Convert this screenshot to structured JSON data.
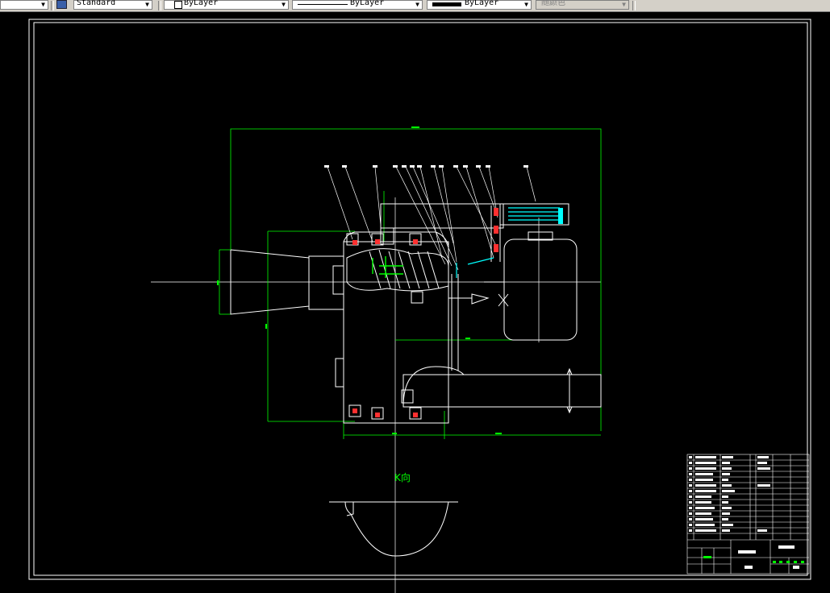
{
  "toolbar": {
    "style_value": "Standard",
    "color_value": "ByLayer",
    "linetype_value": "ByLayer",
    "lineweight_value": "ByLayer",
    "plotstyle_value": "随颜色"
  },
  "drawing": {
    "background": "#000000",
    "colors": {
      "outline": "#ffffff",
      "dimension": "#00ff00",
      "accent": "#00ffff",
      "highlight": "#ff3030"
    },
    "view_label": "K向"
  },
  "icons": {
    "style_icon": "text-style-icon",
    "color_swatch": "color-swatch-icon"
  }
}
